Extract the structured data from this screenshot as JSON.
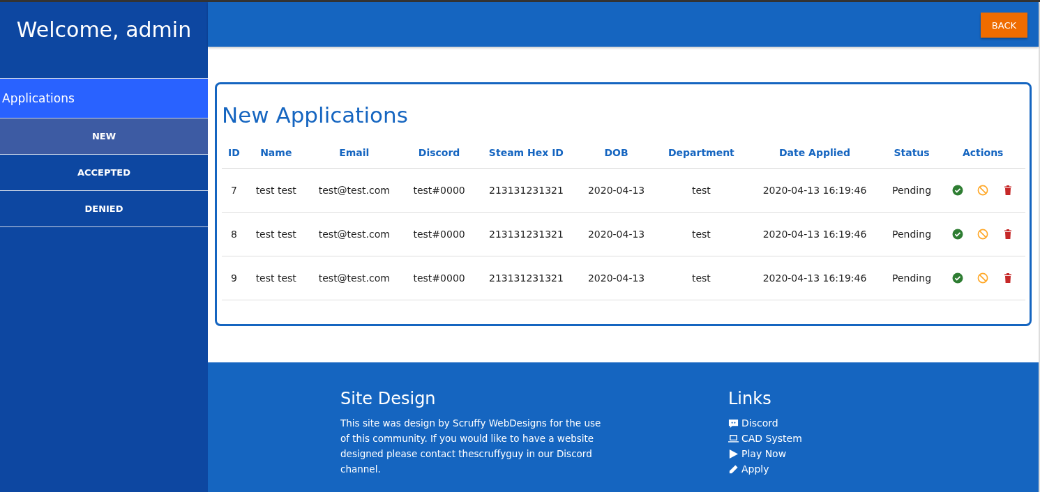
{
  "sidebar": {
    "title": "Welcome, admin",
    "section": "Applications",
    "items": [
      {
        "label": "NEW",
        "selected": true
      },
      {
        "label": "ACCEPTED",
        "selected": false
      },
      {
        "label": "DENIED",
        "selected": false
      }
    ]
  },
  "header": {
    "back_button": "BACK"
  },
  "table": {
    "title": "New Applications",
    "columns": [
      "ID",
      "Name",
      "Email",
      "Discord",
      "Steam Hex ID",
      "DOB",
      "Department",
      "Date Applied",
      "Status",
      "Actions"
    ],
    "rows": [
      {
        "cells": [
          "7",
          "test test",
          "test@test.com",
          "test#0000",
          "213131231321",
          "2020-04-13",
          "test",
          "2020-04-13 16:19:46",
          "Pending"
        ],
        "actions": [
          {
            "kind": "accept"
          },
          {
            "kind": "deny"
          },
          {
            "kind": "delete"
          }
        ]
      },
      {
        "cells": [
          "8",
          "test test",
          "test@test.com",
          "test#0000",
          "213131231321",
          "2020-04-13",
          "test",
          "2020-04-13 16:19:46",
          "Pending"
        ],
        "actions": [
          {
            "kind": "accept"
          },
          {
            "kind": "deny"
          },
          {
            "kind": "delete"
          }
        ]
      },
      {
        "cells": [
          "9",
          "test test",
          "test@test.com",
          "test#0000",
          "213131231321",
          "2020-04-13",
          "test",
          "2020-04-13 16:19:46",
          "Pending"
        ],
        "actions": [
          {
            "kind": "accept"
          },
          {
            "kind": "deny"
          },
          {
            "kind": "delete"
          }
        ]
      }
    ]
  },
  "footer": {
    "about": {
      "title": "Site Design",
      "text": "This site was design by Scruffy WebDesigns for the use of this community. If you would like to have a website designed please contact thescruffyguy in our Discord channel."
    },
    "links": {
      "title": "Links",
      "items": [
        {
          "kind": "chat",
          "label": "Discord"
        },
        {
          "kind": "laptop",
          "label": "CAD System"
        },
        {
          "kind": "play",
          "label": "Play Now"
        },
        {
          "kind": "pencil",
          "label": "Apply"
        }
      ]
    }
  }
}
